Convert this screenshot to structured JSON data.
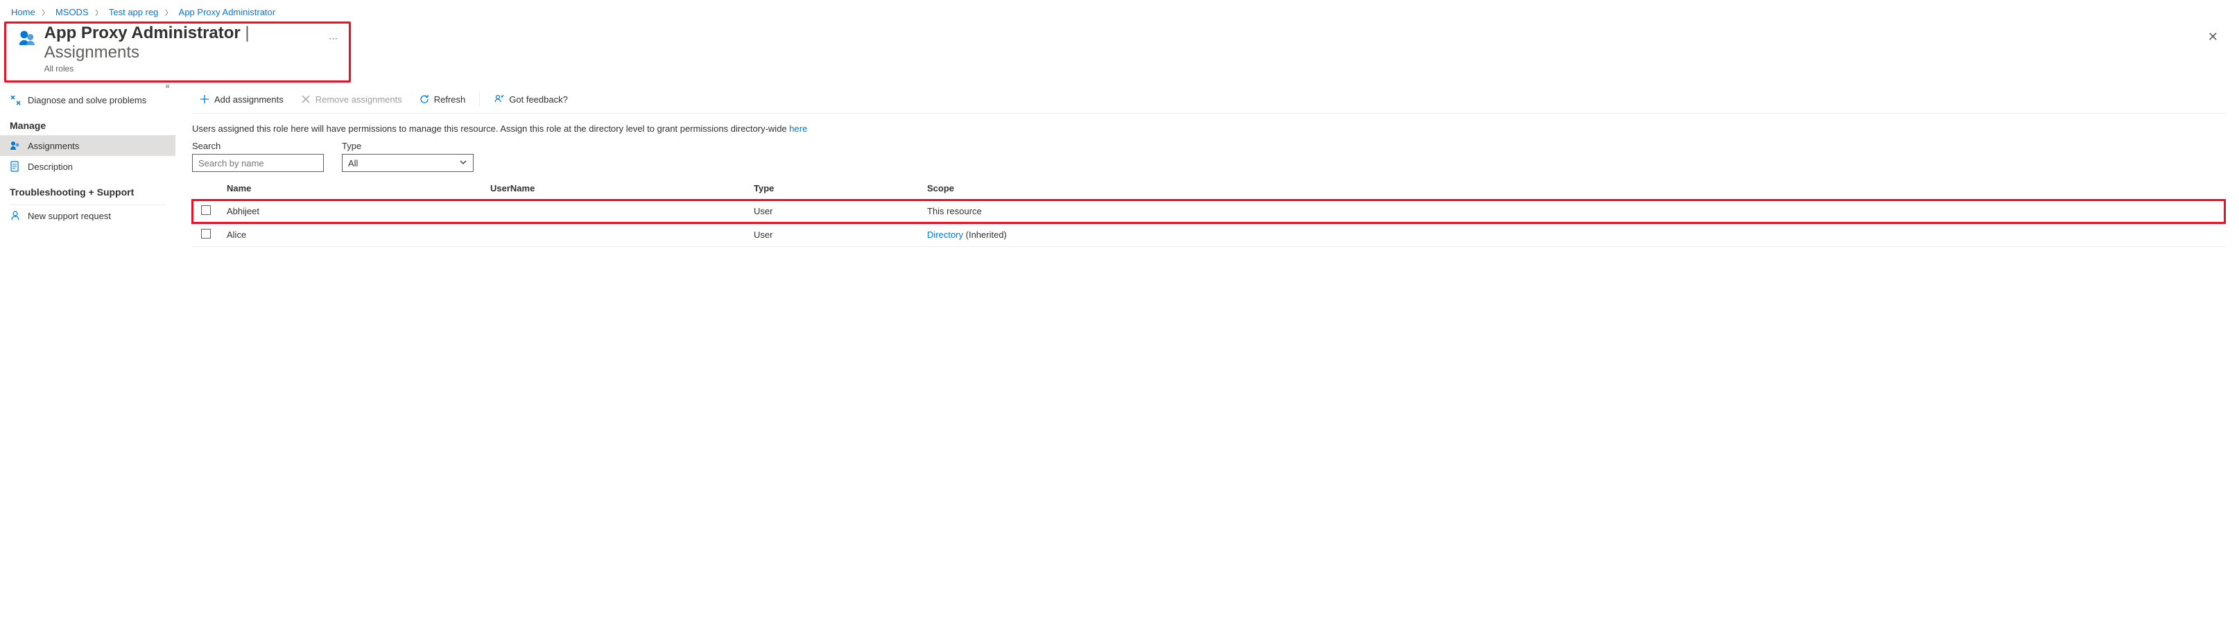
{
  "breadcrumb": {
    "items": [
      "Home",
      "MSODS",
      "Test app reg",
      "App Proxy Administrator"
    ]
  },
  "header": {
    "title_bold": "App Proxy Administrator",
    "title_light": " | Assignments",
    "subtitle": "All roles"
  },
  "sidebar": {
    "diagnose": "Diagnose and solve problems",
    "section_manage": "Manage",
    "assignments": "Assignments",
    "description": "Description",
    "section_trouble": "Troubleshooting + Support",
    "support_request": "New support request"
  },
  "toolbar": {
    "add": "Add assignments",
    "remove": "Remove assignments",
    "refresh": "Refresh",
    "feedback": "Got feedback?"
  },
  "info": {
    "text": "Users assigned this role here will have permissions to manage this resource. Assign this role at the directory level to grant permissions directory-wide ",
    "link": "here"
  },
  "filters": {
    "search_label": "Search",
    "search_placeholder": "Search by name",
    "type_label": "Type",
    "type_value": "All"
  },
  "table": {
    "headers": {
      "name": "Name",
      "username": "UserName",
      "type": "Type",
      "scope": "Scope"
    },
    "rows": [
      {
        "name": "Abhijeet",
        "username": "",
        "type": "User",
        "scope_text": "This resource",
        "scope_link": "",
        "scope_suffix": "",
        "highlight": true
      },
      {
        "name": "Alice",
        "username": "",
        "type": "User",
        "scope_text": "",
        "scope_link": "Directory",
        "scope_suffix": " (Inherited)",
        "highlight": false
      }
    ]
  }
}
